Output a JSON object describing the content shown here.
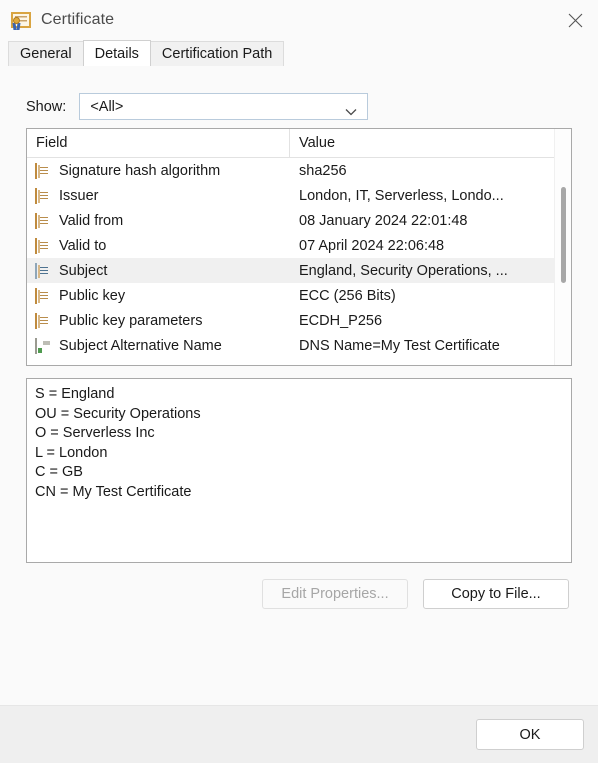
{
  "window": {
    "title": "Certificate",
    "icon": "certificate-icon",
    "close_label": "✕"
  },
  "tabs": [
    {
      "label": "General",
      "active": false
    },
    {
      "label": "Details",
      "active": true
    },
    {
      "label": "Certification Path",
      "active": false
    }
  ],
  "show": {
    "label": "Show:",
    "value": "<All>",
    "options": [
      "<All>"
    ]
  },
  "field_list": {
    "columns": [
      "Field",
      "Value"
    ],
    "rows": [
      {
        "icon": "document-icon",
        "field": "Signature hash algorithm",
        "value": "sha256",
        "selected": false
      },
      {
        "icon": "document-icon",
        "field": "Issuer",
        "value": "London, IT, Serverless, Londo...",
        "selected": false
      },
      {
        "icon": "document-icon",
        "field": "Valid from",
        "value": "08 January 2024 22:01:48",
        "selected": false
      },
      {
        "icon": "document-icon",
        "field": "Valid to",
        "value": "07 April 2024 22:06:48",
        "selected": false
      },
      {
        "icon": "document-icon",
        "field": "Subject",
        "value": "England, Security Operations, ...",
        "selected": true
      },
      {
        "icon": "document-icon",
        "field": "Public key",
        "value": "ECC (256 Bits)",
        "selected": false
      },
      {
        "icon": "document-icon",
        "field": "Public key parameters",
        "value": "ECDH_P256",
        "selected": false
      },
      {
        "icon": "extension-icon",
        "field": "Subject Alternative Name",
        "value": "DNS Name=My Test Certificate",
        "selected": false
      }
    ]
  },
  "detail": {
    "lines": [
      "S = England",
      "OU = Security Operations",
      "O = Serverless Inc",
      "L = London",
      "C = GB",
      "CN = My Test Certificate"
    ]
  },
  "actions": {
    "edit_properties": "Edit Properties...",
    "edit_properties_enabled": false,
    "copy_to_file": "Copy to File...",
    "copy_to_file_enabled": true
  },
  "footer": {
    "ok": "OK"
  },
  "colors": {
    "dialog_bg": "#fafafa",
    "footer_bg": "#efefef",
    "listbox_border": "#a9a9a9",
    "selection_bg": "#f0f0f0",
    "combo_border": "#b9cbdc",
    "text": "#1a1a1a",
    "title_text": "#4a4a4a",
    "disabled_text": "#a6a6a6"
  }
}
